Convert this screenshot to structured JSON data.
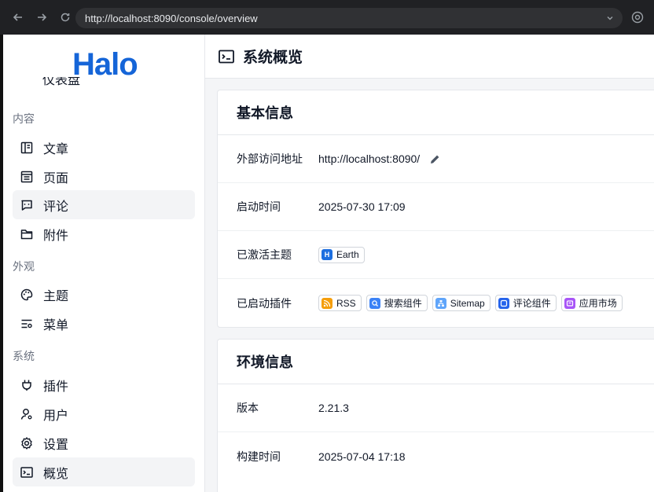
{
  "browser": {
    "url": "http://localhost:8090/console/overview"
  },
  "sidebar": {
    "logo": "Halo",
    "partial_item": "仪表盘",
    "sections": [
      {
        "label": "内容"
      },
      {
        "label": "外观"
      },
      {
        "label": "系统"
      }
    ],
    "items": [
      {
        "label": "文章",
        "icon": "book-icon"
      },
      {
        "label": "页面",
        "icon": "page-icon"
      },
      {
        "label": "评论",
        "icon": "comment-icon",
        "active": true
      },
      {
        "label": "附件",
        "icon": "folder-icon"
      },
      {
        "label": "主题",
        "icon": "palette-icon"
      },
      {
        "label": "菜单",
        "icon": "menu-list-icon"
      },
      {
        "label": "插件",
        "icon": "plug-icon"
      },
      {
        "label": "用户",
        "icon": "user-icon"
      },
      {
        "label": "设置",
        "icon": "settings-icon"
      },
      {
        "label": "概览",
        "icon": "terminal-icon",
        "active": true
      }
    ]
  },
  "header": {
    "title": "系统概览"
  },
  "basic_info": {
    "title": "基本信息",
    "external_url_label": "外部访问地址",
    "external_url": "http://localhost:8090/",
    "start_time_label": "启动时间",
    "start_time": "2025-07-30 17:09",
    "active_theme_label": "已激活主题",
    "active_theme": "Earth",
    "plugins_label": "已启动插件",
    "plugins": [
      {
        "name": "RSS",
        "color": "#f59e0b"
      },
      {
        "name": "搜索组件",
        "color": "#3b82f6"
      },
      {
        "name": "Sitemap",
        "color": "#60a5fa"
      },
      {
        "name": "评论组件",
        "color": "#2563eb"
      },
      {
        "name": "应用市场",
        "color": "#a855f7"
      }
    ]
  },
  "env_info": {
    "title": "环境信息",
    "version_label": "版本",
    "version": "2.21.3",
    "build_time_label": "构建时间",
    "build_time": "2025-07-04 17:18"
  },
  "colors": {
    "brand": "#1565d8",
    "active_bg": "#f3f4f6"
  }
}
